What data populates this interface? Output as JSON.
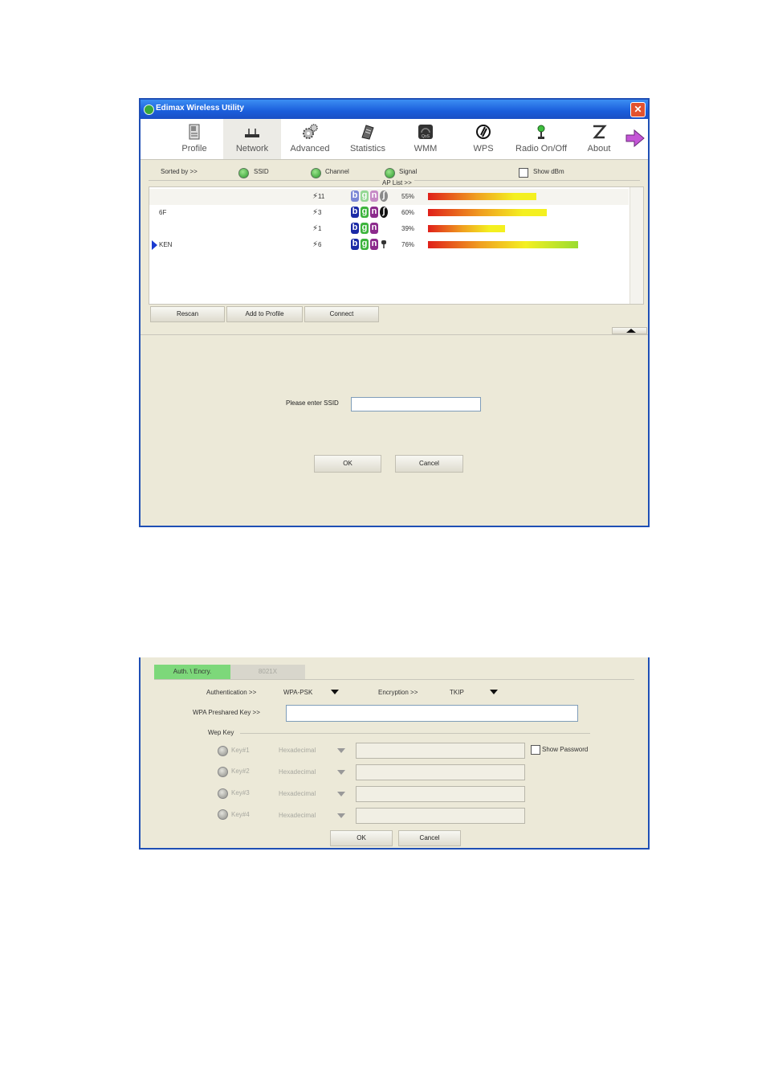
{
  "window1": {
    "title": "Edimax Wireless Utility",
    "toolbar": [
      {
        "label": "Profile",
        "icon": "profile-icon"
      },
      {
        "label": "Network",
        "icon": "network-icon"
      },
      {
        "label": "Advanced",
        "icon": "gears-icon"
      },
      {
        "label": "Statistics",
        "icon": "statistics-icon"
      },
      {
        "label": "WMM",
        "icon": "wmm-icon"
      },
      {
        "label": "WPS",
        "icon": "wps-icon"
      },
      {
        "label": "Radio On/Off",
        "icon": "radio-icon"
      },
      {
        "label": "About",
        "icon": "about-icon"
      }
    ],
    "sorted_by": "Sorted by >>",
    "sort_ssid": "SSID",
    "sort_channel": "Channel",
    "sort_signal": "Signal",
    "show_dbm": "Show dBm",
    "ap_list_label": "AP List >>",
    "ap_list": [
      {
        "ssid": "",
        "channel": "11",
        "signal": "55%",
        "signal_value": 55,
        "modes": [
          "b",
          "g",
          "n"
        ],
        "extra": "wps"
      },
      {
        "ssid": "6F",
        "channel": "3",
        "signal": "60%",
        "signal_value": 60,
        "modes": [
          "b",
          "g",
          "n"
        ],
        "extra": "wps"
      },
      {
        "ssid": "",
        "channel": "1",
        "signal": "39%",
        "signal_value": 39,
        "modes": [
          "b",
          "g",
          "n"
        ],
        "extra": ""
      },
      {
        "ssid": "KEN",
        "channel": "6",
        "signal": "76%",
        "signal_value": 76,
        "modes": [
          "b",
          "g",
          "n"
        ],
        "extra": "lock"
      }
    ],
    "rescan": "Rescan",
    "add_to_profile": "Add to Profile",
    "connect": "Connect",
    "ssid_prompt": "Please enter SSID",
    "ssid_value": "",
    "ok": "OK",
    "cancel": "Cancel"
  },
  "window2": {
    "tab_auth": "Auth. \\ Encry.",
    "tab_8021x": "8021X",
    "authentication_label": "Authentication >>",
    "authentication_value": "WPA-PSK",
    "encryption_label": "Encryption >>",
    "encryption_value": "TKIP",
    "wpa_key_label": "WPA Preshared Key >>",
    "wpa_key_value": "",
    "wep_key_label": "Wep Key",
    "keys": [
      {
        "label": "Key#1",
        "format": "Hexadecimal"
      },
      {
        "label": "Key#2",
        "format": "Hexadecimal"
      },
      {
        "label": "Key#3",
        "format": "Hexadecimal"
      },
      {
        "label": "Key#4",
        "format": "Hexadecimal"
      }
    ],
    "show_password": "Show Password",
    "ok": "OK",
    "cancel": "Cancel"
  },
  "colors": {
    "title_bar": "#1a5ddb",
    "window_border": "#1f4fb5",
    "active_tab": "#7dd87a",
    "badge_b": "#1b2aa6",
    "badge_g": "#3cb43c",
    "badge_n": "#8c2a8c"
  }
}
